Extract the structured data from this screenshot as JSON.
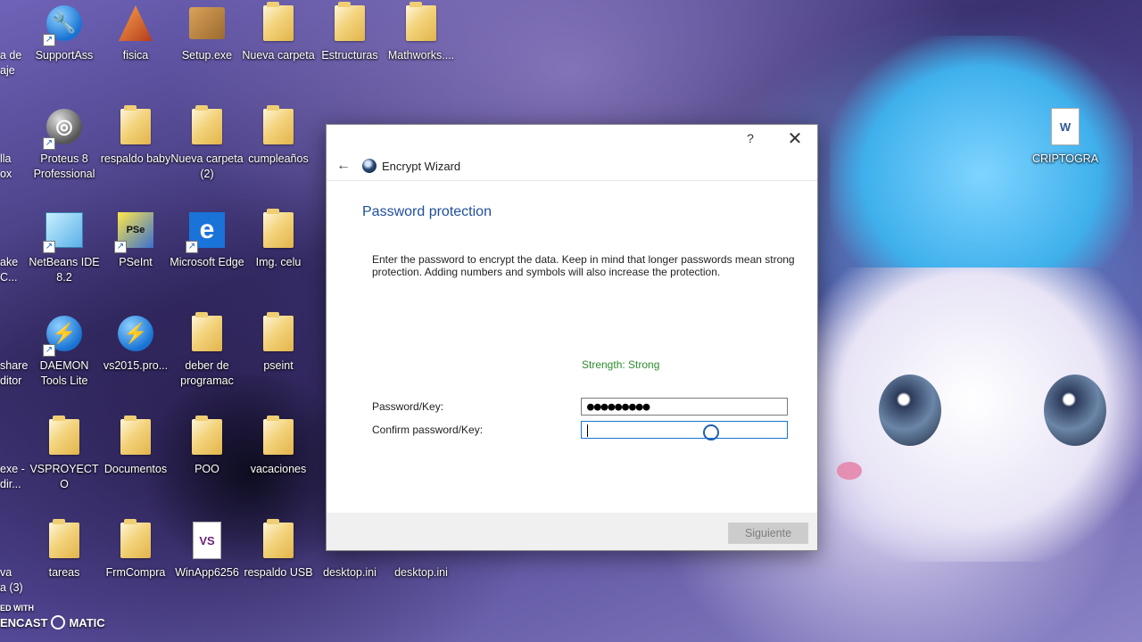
{
  "desktop": {
    "left_partial": [
      "a de",
      "aje",
      "lla",
      "ox",
      "ake",
      "C...",
      "share",
      "ditor",
      "exe -",
      "dir...",
      "va",
      "a (3)"
    ],
    "icons": [
      {
        "label": "SupportAss",
        "icon": "support-assist-icon"
      },
      {
        "label": "fisica",
        "icon": "matlab-icon"
      },
      {
        "label": "Setup.exe",
        "icon": "setup-icon"
      },
      {
        "label": "Nueva carpeta",
        "icon": "folder-icon"
      },
      {
        "label": "Estructuras",
        "icon": "folder-icon"
      },
      {
        "label": "Mathworks....",
        "icon": "folder-icon"
      },
      {
        "label": "Proteus 8 Professional",
        "icon": "proteus-icon"
      },
      {
        "label": "respaldo baby",
        "icon": "folder-icon"
      },
      {
        "label": "Nueva carpeta (2)",
        "icon": "folder-icon"
      },
      {
        "label": "cumpleaños",
        "icon": "folder-icon"
      },
      {
        "label": "NetBeans IDE 8.2",
        "icon": "netbeans-icon"
      },
      {
        "label": "PSeInt",
        "icon": "pseint-icon"
      },
      {
        "label": "Microsoft Edge",
        "icon": "edge-icon"
      },
      {
        "label": "Img. celu",
        "icon": "folder-icon"
      },
      {
        "label": "DAEMON Tools Lite",
        "icon": "daemon-tools-icon"
      },
      {
        "label": "vs2015.pro...",
        "icon": "daemon-tools-icon"
      },
      {
        "label": "deber de programac",
        "icon": "folder-icon"
      },
      {
        "label": "pseint",
        "icon": "folder-icon"
      },
      {
        "label": "VSPROYECTO",
        "icon": "folder-icon"
      },
      {
        "label": "Documentos",
        "icon": "folder-icon"
      },
      {
        "label": "POO",
        "icon": "folder-icon"
      },
      {
        "label": "vacaciones",
        "icon": "folder-icon"
      },
      {
        "label": "tareas",
        "icon": "folder-icon"
      },
      {
        "label": "FrmCompra",
        "icon": "folder-icon"
      },
      {
        "label": "WinApp6256",
        "icon": "vs-file-icon"
      },
      {
        "label": "respaldo USB",
        "icon": "folder-icon"
      },
      {
        "label": "desktop.ini",
        "icon": "ini-file-icon"
      },
      {
        "label": "desktop.ini",
        "icon": "ini-file-icon"
      },
      {
        "label": "CRIPTOGRA",
        "icon": "word-doc-icon"
      }
    ]
  },
  "dialog": {
    "help": "?",
    "close": "✕",
    "back": "←",
    "app_title": "Encrypt Wizard",
    "section_title": "Password protection",
    "description": "Enter the password to encrypt the data. Keep in mind that longer passwords mean strong protection. Adding numbers and symbols will also increase the protection.",
    "strength": "Strength: Strong",
    "password_label": "Password/Key:",
    "password_value": "●●●●●●●●●",
    "confirm_label": "Confirm password/Key:",
    "confirm_value": "",
    "next_button": "Siguiente"
  },
  "watermark": {
    "line1": "ED WITH",
    "line2a": "ENCAST",
    "line2b": "MATIC"
  }
}
